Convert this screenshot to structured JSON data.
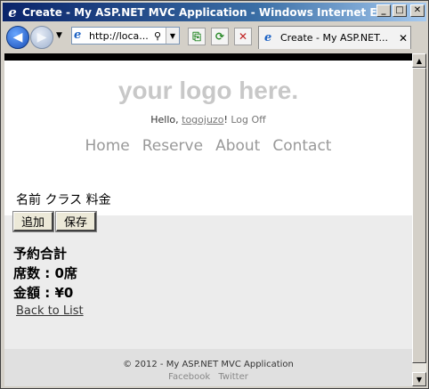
{
  "window": {
    "title": "Create - My ASP.NET MVC Application - Windows Internet Expl...",
    "ie_glyph": "e",
    "minimize": "_",
    "maximize": "□",
    "close": "✕"
  },
  "toolbar": {
    "back_icon": "arrow-left-icon",
    "forward_icon": "arrow-right-icon",
    "address_text": "http://loca...",
    "search_glyph": "⚲",
    "dropdown_glyph": "▼",
    "compat_glyph": "⎘",
    "refresh_glyph": "⟳",
    "stop_glyph": "✕",
    "tab_label": "Create - My ASP.NET...",
    "tab_close": "✕"
  },
  "site": {
    "logo": "your logo here.",
    "hello": "Hello, ",
    "user": "togojuzo",
    "exclaim": "! ",
    "logoff": "Log Off",
    "menu": [
      "Home",
      "Reserve",
      "About",
      "Contact"
    ]
  },
  "form": {
    "columns": "名前 クラス 料金",
    "add_label": "追加",
    "save_label": "保存",
    "summary_title": "予約合計",
    "seats_line": "席数 : 0席",
    "amount_line": "金額 : ¥0",
    "back_link": "Back to List"
  },
  "footer": {
    "copyright": "© 2012 - My ASP.NET MVC Application",
    "facebook": "Facebook",
    "twitter": "Twitter"
  }
}
